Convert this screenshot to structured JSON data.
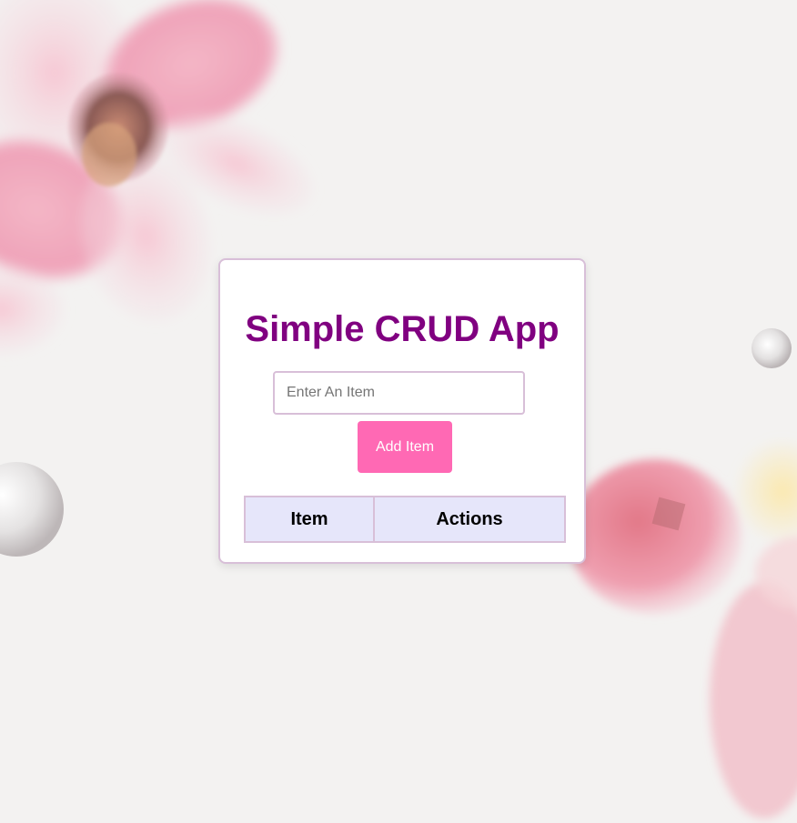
{
  "app": {
    "title": "Simple CRUD App"
  },
  "form": {
    "input_value": "",
    "input_placeholder": "Enter An Item",
    "add_button_label": "Add Item"
  },
  "table": {
    "columns": [
      "Item",
      "Actions"
    ],
    "rows": []
  },
  "theme": {
    "title_color": "#800080",
    "button_color": "#ff69b4",
    "border_color": "#d8bfd8",
    "header_bg": "#e6e6fa",
    "background": "#f3f2f1"
  }
}
